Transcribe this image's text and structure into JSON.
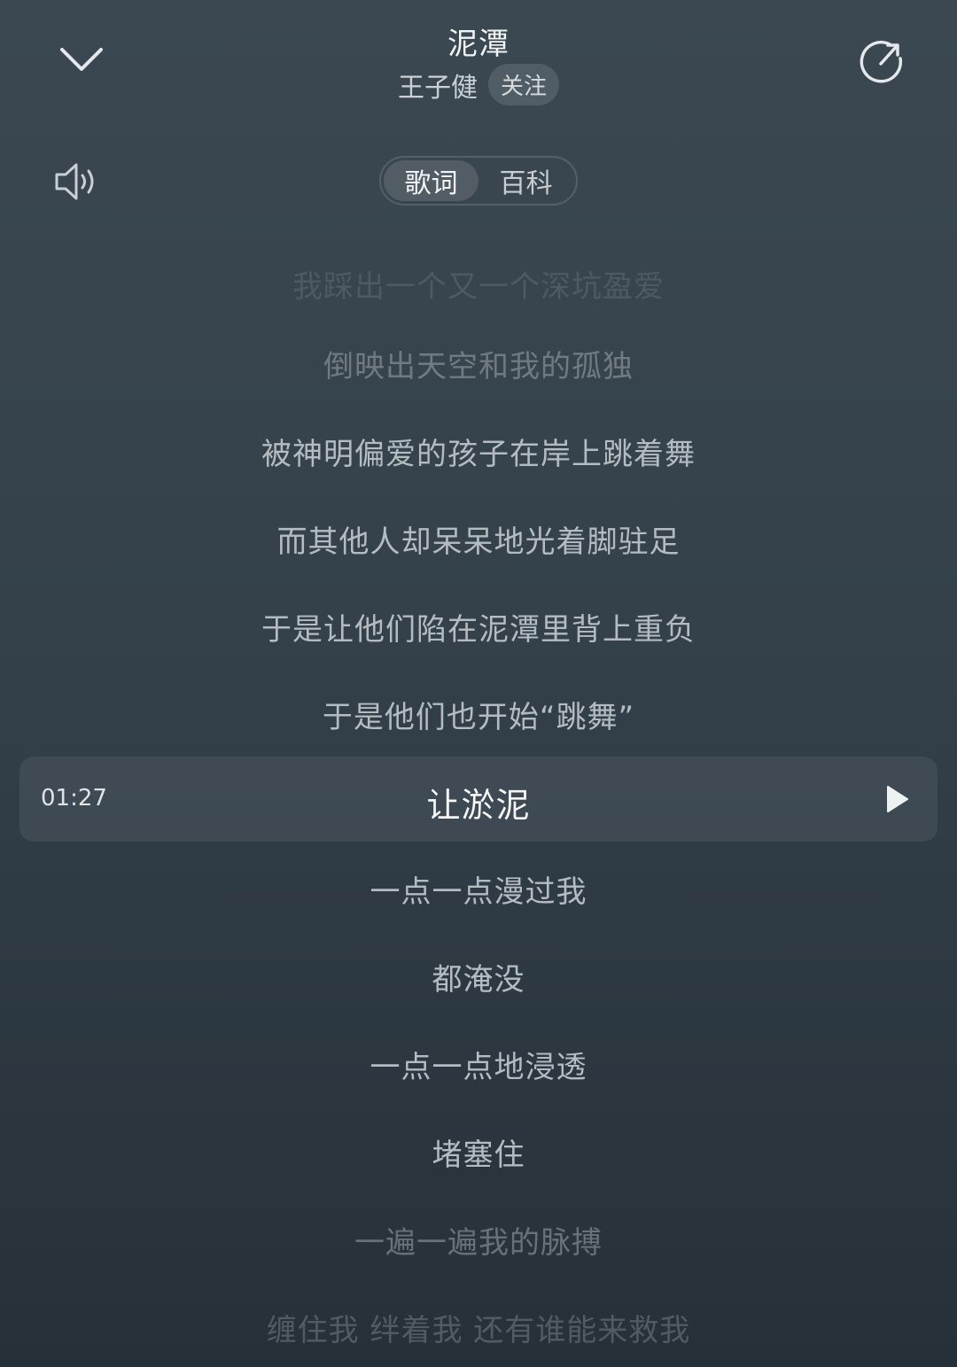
{
  "header": {
    "title": "泥潭",
    "artist": "王子健",
    "follow_label": "关注",
    "back_icon": "chevron-down-icon",
    "share_icon": "share-icon"
  },
  "controls": {
    "volume_icon": "volume-icon",
    "tabs": [
      {
        "label": "歌词",
        "active": true
      },
      {
        "label": "百科",
        "active": false
      }
    ]
  },
  "lyrics": {
    "lines_before": [
      "我踩出一个又一个深坑盈爱",
      "倒映出天空和我的孤独",
      "被神明偏爱的孩子在岸上跳着舞",
      "而其他人却呆呆地光着脚驻足",
      "于是让他们陷在泥潭里背上重负",
      "于是他们也开始“跳舞”"
    ],
    "current": {
      "time": "01:27",
      "text": "让淤泥"
    },
    "lines_after": [
      "一点一点漫过我",
      "都淹没",
      "一点一点地浸透",
      "堵塞住",
      "一遍一遍我的脉搏",
      "缠住我 绊着我 还有谁能来救我"
    ]
  },
  "colors": {
    "background_top": "#3b4852",
    "background_bottom": "#263038",
    "lyric_text": "#b5bcc1",
    "highlight_text": "#f4f6f7"
  }
}
